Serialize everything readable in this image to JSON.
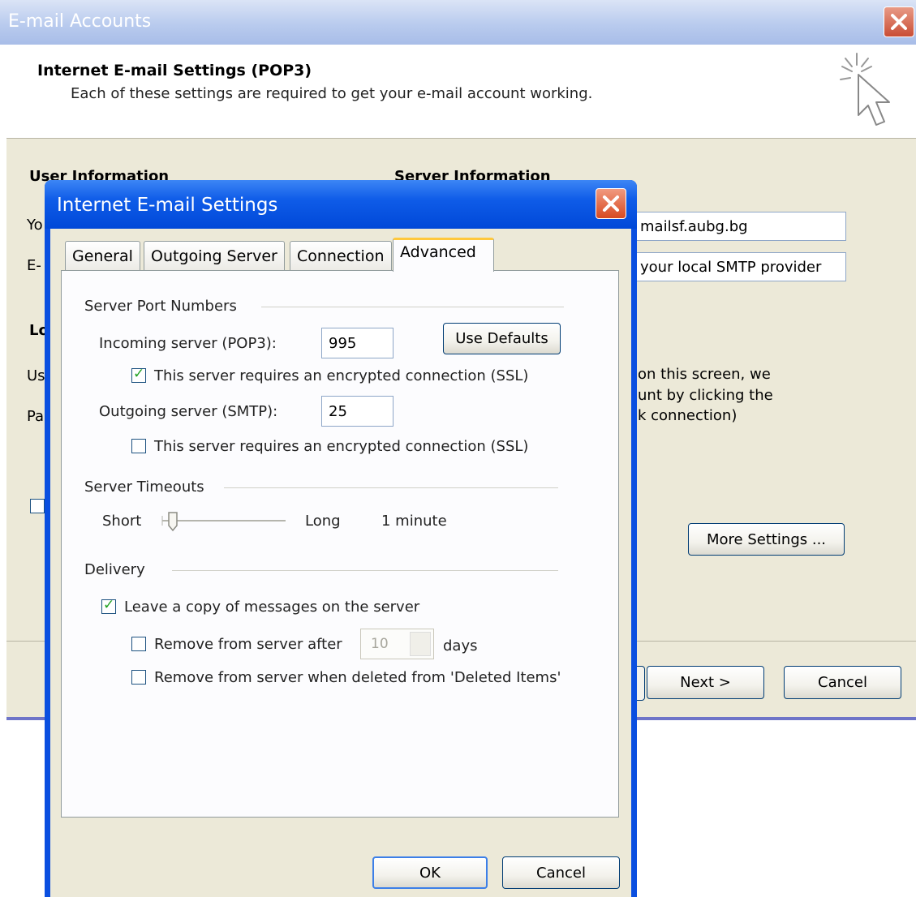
{
  "wizard": {
    "title": "E-mail Accounts",
    "header_title": "Internet E-mail Settings (POP3)",
    "header_subtitle": "Each of these settings are required to get your e-mail account working.",
    "user_info_heading": "User Information",
    "server_info_heading": "Server Information",
    "label_yo": "Yo",
    "label_e": "E-",
    "label_lo": "Lo",
    "label_us": "Us",
    "label_pa": "Pa",
    "incoming_server_value": "mailsf.aubg.bg",
    "outgoing_server_value": "your local SMTP provider",
    "note_line1": "on this screen, we",
    "note_line2": "unt by clicking the",
    "note_line3": "k connection)",
    "more_settings_label": "More Settings ...",
    "next_label": "Next >",
    "cancel_label": "Cancel"
  },
  "dialog": {
    "title": "Internet E-mail Settings",
    "tabs": [
      {
        "label": "General"
      },
      {
        "label": "Outgoing Server"
      },
      {
        "label": "Connection"
      },
      {
        "label": "Advanced"
      }
    ],
    "port_section": "Server Port Numbers",
    "incoming_label": "Incoming server (POP3):",
    "incoming_port": "995",
    "use_defaults_label": "Use Defaults",
    "incoming_ssl_label": "This server requires an encrypted connection (SSL)",
    "incoming_ssl_checked": true,
    "outgoing_label": "Outgoing server (SMTP):",
    "outgoing_port": "25",
    "outgoing_ssl_label": "This server requires an encrypted connection (SSL)",
    "outgoing_ssl_checked": false,
    "timeouts_section": "Server Timeouts",
    "timeout_short": "Short",
    "timeout_long": "Long",
    "timeout_value": "1 minute",
    "delivery_section": "Delivery",
    "leave_copy_label": "Leave a copy of messages on the server",
    "leave_copy_checked": true,
    "remove_after_label": "Remove from server after",
    "remove_after_days": "10",
    "days_label": "days",
    "remove_deleted_label": "Remove from server when deleted from 'Deleted Items'",
    "ok_label": "OK",
    "cancel_label": "Cancel"
  },
  "colors": {
    "dialog_title_blue": "#0a4fe0",
    "wizard_title_blue": "#b9cbee",
    "panel_beige": "#ece9d8",
    "check_green": "#21a121",
    "active_tab_accent": "#ffc83c"
  }
}
